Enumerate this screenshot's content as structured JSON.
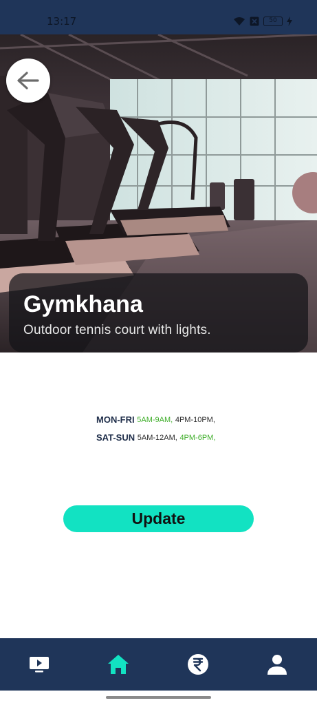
{
  "status_bar": {
    "time": "13:17",
    "battery": "50"
  },
  "hero": {
    "image": "gym-treadmills-photo"
  },
  "venue": {
    "title": "Gymkhana",
    "subtitle": "Outdoor tennis court with lights."
  },
  "schedule": [
    {
      "day": "MON-FRI",
      "slots": [
        {
          "text": "5AM-9AM,",
          "status": "available"
        },
        {
          "text": "4PM-10PM,",
          "status": "booked"
        }
      ]
    },
    {
      "day": "SAT-SUN",
      "slots": [
        {
          "text": "5AM-12AM,",
          "status": "booked"
        },
        {
          "text": "4PM-6PM,",
          "status": "available"
        }
      ]
    }
  ],
  "actions": {
    "update_label": "Update"
  },
  "bottom_nav": [
    {
      "icon": "tv-play-icon",
      "active": false
    },
    {
      "icon": "home-icon",
      "active": true
    },
    {
      "icon": "rupee-icon",
      "active": false
    },
    {
      "icon": "profile-icon",
      "active": false
    }
  ],
  "colors": {
    "navy": "#1f3559",
    "accent": "#12e2c2",
    "available": "#3fae2a",
    "text_dark": "#1f2e4a"
  }
}
